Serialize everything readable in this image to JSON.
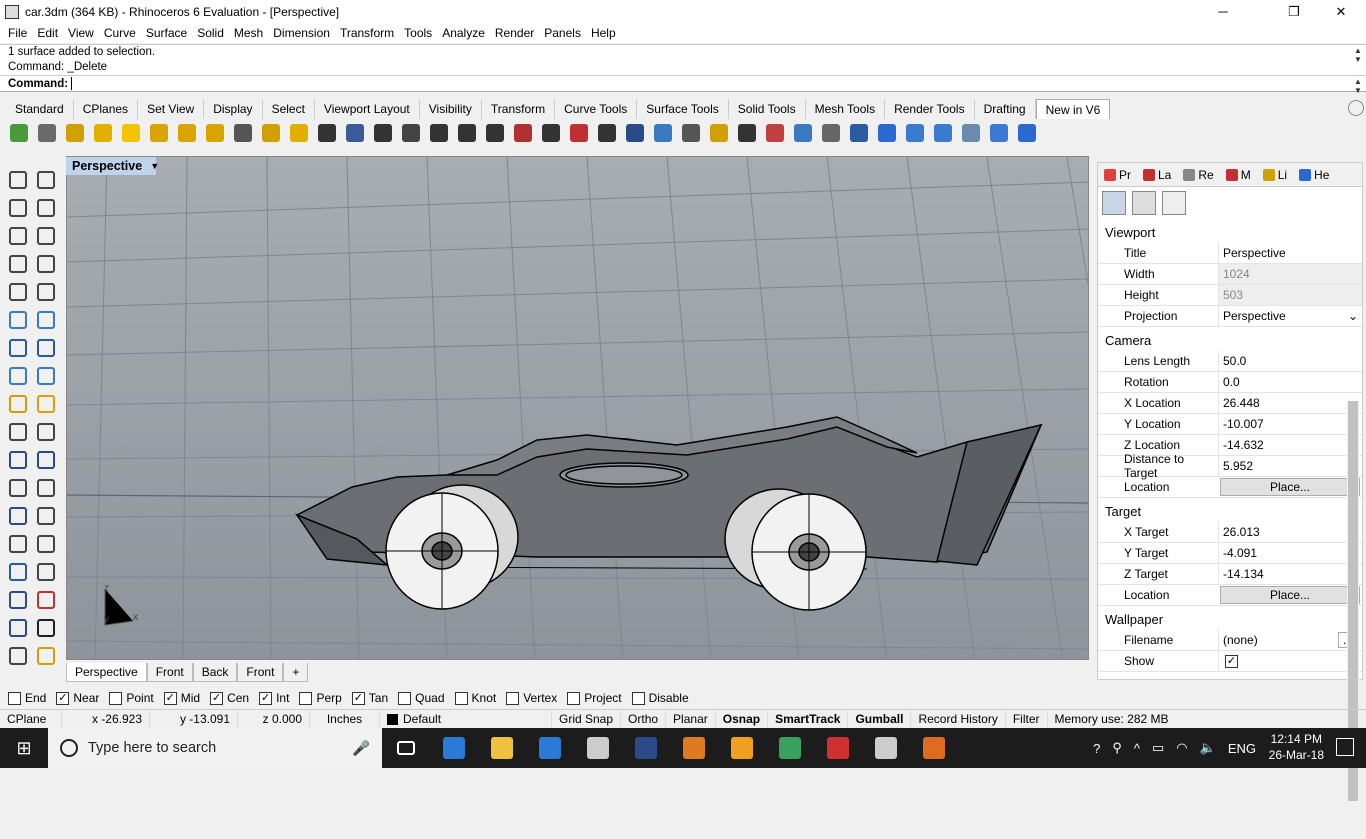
{
  "window": {
    "title": "car.3dm (364 KB) - Rhinoceros 6 Evaluation - [Perspective]",
    "controls": {
      "minimize": "─",
      "restore": "❐",
      "close": "✕"
    }
  },
  "menu": [
    "File",
    "Edit",
    "View",
    "Curve",
    "Surface",
    "Solid",
    "Mesh",
    "Dimension",
    "Transform",
    "Tools",
    "Analyze",
    "Render",
    "Panels",
    "Help"
  ],
  "command_history": [
    "1 surface added to selection.",
    "Command: _Delete"
  ],
  "command_prompt": "Command:",
  "toolbar_tabs": [
    "Standard",
    "CPlanes",
    "Set View",
    "Display",
    "Select",
    "Viewport Layout",
    "Visibility",
    "Transform",
    "Curve Tools",
    "Surface Tools",
    "Solid Tools",
    "Mesh Tools",
    "Render Tools",
    "Drafting",
    "New in V6"
  ],
  "toolbar_tabs_active": "New in V6",
  "toolbar_icons": [
    {
      "name": "sphere-icon",
      "color": "#4a9a3a"
    },
    {
      "name": "cplane-icon",
      "color": "#6a6a6a"
    },
    {
      "name": "lock-icon",
      "color": "#cfa000"
    },
    {
      "name": "picture-icon",
      "color": "#e1b000"
    },
    {
      "name": "light-icon",
      "color": "#f3c400"
    },
    {
      "name": "key-icon",
      "color": "#d9a300"
    },
    {
      "name": "point-icon",
      "color": "#d9a300"
    },
    {
      "name": "points-icon",
      "color": "#d9a300"
    },
    {
      "name": "rotate-icon",
      "color": "#555"
    },
    {
      "name": "grid-icon",
      "color": "#d0a000"
    },
    {
      "name": "box-icon",
      "color": "#e0b000"
    },
    {
      "name": "curve-icon",
      "color": "#333"
    },
    {
      "name": "brush-icon",
      "color": "#3a5a9a"
    },
    {
      "name": "fence-icon",
      "color": "#333"
    },
    {
      "name": "gauge-icon",
      "color": "#444"
    },
    {
      "name": "vsplit-icon",
      "color": "#333"
    },
    {
      "name": "lines-icon",
      "color": "#333"
    },
    {
      "name": "align-icon",
      "color": "#333"
    },
    {
      "name": "histogram-icon",
      "color": "#b03030"
    },
    {
      "name": "number-icon",
      "color": "#333"
    },
    {
      "name": "pen-icon",
      "color": "#c03030"
    },
    {
      "name": "sign-icon",
      "color": "#333"
    },
    {
      "name": "monitor-icon",
      "color": "#2a4a8a"
    },
    {
      "name": "drape-icon",
      "color": "#3a7ac0"
    },
    {
      "name": "wave-icon",
      "color": "#555"
    },
    {
      "name": "hook-icon",
      "color": "#d0a000"
    },
    {
      "name": "zoom-icon",
      "color": "#333"
    },
    {
      "name": "globe-icon",
      "color": "#c04040"
    },
    {
      "name": "select-icon",
      "color": "#3a7ac0"
    },
    {
      "name": "mesh-icon",
      "color": "#666"
    },
    {
      "name": "block-icon",
      "color": "#2a5aa0"
    },
    {
      "name": "download-icon",
      "color": "#2a6ad0"
    },
    {
      "name": "hexagon-icon",
      "color": "#3a7ad0"
    },
    {
      "name": "hexagon-outline-icon",
      "color": "#3a7ad0"
    },
    {
      "name": "chrome-icon",
      "color": "#6a8ab0"
    },
    {
      "name": "ski-icon",
      "color": "#3a7ad0"
    },
    {
      "name": "cube-select-icon",
      "color": "#2a6ad0"
    }
  ],
  "left_tools": [
    {
      "name": "select-arrow-icon",
      "color": "#444"
    },
    {
      "name": "point-dot-icon",
      "color": "#444"
    },
    {
      "name": "polyline-icon",
      "color": "#444"
    },
    {
      "name": "curve-points-icon",
      "color": "#444"
    },
    {
      "name": "circle-icon",
      "color": "#444"
    },
    {
      "name": "ellipse-icon",
      "color": "#444"
    },
    {
      "name": "polygon-icon",
      "color": "#444"
    },
    {
      "name": "rectangle-icon",
      "color": "#444"
    },
    {
      "name": "circle-center-icon",
      "color": "#444"
    },
    {
      "name": "fillet-icon",
      "color": "#444"
    },
    {
      "name": "surface-corners-icon",
      "color": "#3a7ac0"
    },
    {
      "name": "surface-edge-icon",
      "color": "#3a7ac0"
    },
    {
      "name": "box-solid-icon",
      "color": "#2a5aa0"
    },
    {
      "name": "spheres-icon",
      "color": "#2a5aa0"
    },
    {
      "name": "cylinder-icon",
      "color": "#3a7ac0"
    },
    {
      "name": "plane-mesh-icon",
      "color": "#3a7ac0"
    },
    {
      "name": "explode-icon",
      "color": "#d0a000"
    },
    {
      "name": "lightning-icon",
      "color": "#e0a000"
    },
    {
      "name": "split-icon",
      "color": "#444"
    },
    {
      "name": "trim-icon",
      "color": "#444"
    },
    {
      "name": "boolean-icon",
      "color": "#2a4a8a"
    },
    {
      "name": "group-icon",
      "color": "#2a4a8a"
    },
    {
      "name": "rebuild-icon",
      "color": "#444"
    },
    {
      "name": "extend-icon",
      "color": "#444"
    },
    {
      "name": "text-icon",
      "color": "#2a4a8a"
    },
    {
      "name": "dimension-icon",
      "color": "#444"
    },
    {
      "name": "array-icon",
      "color": "#444"
    },
    {
      "name": "bend-icon",
      "color": "#444"
    },
    {
      "name": "cube-blue-icon",
      "color": "#2a5aa0"
    },
    {
      "name": "curve-flat-icon",
      "color": "#444"
    },
    {
      "name": "points-grid-icon",
      "color": "#2a4a8a"
    },
    {
      "name": "gumball-icon",
      "color": "#c03030"
    },
    {
      "name": "paint-icon",
      "color": "#2a4a8a"
    },
    {
      "name": "check-icon",
      "color": "#222"
    },
    {
      "name": "render-icon",
      "color": "#444"
    },
    {
      "name": "material-icon",
      "color": "#d0a000"
    }
  ],
  "viewport": {
    "label": "Perspective",
    "axes": {
      "z": "z",
      "y": "y",
      "x": "x"
    },
    "tabs": [
      "Perspective",
      "Front",
      "Back",
      "Front"
    ],
    "tabs_active": "Perspective",
    "add_tab": "+"
  },
  "panel": {
    "tabs": [
      {
        "label": "Pr",
        "icon": "properties-icon",
        "color": "#e04040"
      },
      {
        "label": "La",
        "icon": "layers-icon",
        "color": "#c03030"
      },
      {
        "label": "Re",
        "icon": "render-settings-icon",
        "color": "#888"
      },
      {
        "label": "M",
        "icon": "materials-icon",
        "color": "#c03030"
      },
      {
        "label": "Li",
        "icon": "libraries-icon",
        "color": "#d0a000"
      },
      {
        "label": "He",
        "icon": "help-icon",
        "color": "#2a6ad0"
      }
    ],
    "viewport_section": "Viewport",
    "camera_section": "Camera",
    "target_section": "Target",
    "wallpaper_section": "Wallpaper",
    "viewport_props": [
      {
        "k": "Title",
        "v": "Perspective"
      },
      {
        "k": "Width",
        "v": "1024"
      },
      {
        "k": "Height",
        "v": "503"
      },
      {
        "k": "Projection",
        "v": "Perspective"
      }
    ],
    "camera_props": [
      {
        "k": "Lens Length",
        "v": "50.0"
      },
      {
        "k": "Rotation",
        "v": "0.0"
      },
      {
        "k": "X Location",
        "v": "26.448"
      },
      {
        "k": "Y Location",
        "v": "-10.007"
      },
      {
        "k": "Z Location",
        "v": "-14.632"
      },
      {
        "k": "Distance to Target",
        "v": "5.952"
      },
      {
        "k": "Location",
        "v": "Place..."
      }
    ],
    "target_props": [
      {
        "k": "X Target",
        "v": "26.013"
      },
      {
        "k": "Y Target",
        "v": "-4.091"
      },
      {
        "k": "Z Target",
        "v": "-14.134"
      },
      {
        "k": "Location",
        "v": "Place..."
      }
    ],
    "wallpaper_props": [
      {
        "k": "Filename",
        "v": "(none)"
      },
      {
        "k": "Show",
        "v": "✓"
      }
    ],
    "filename_button": "..."
  },
  "osnaps": [
    {
      "label": "End",
      "checked": false
    },
    {
      "label": "Near",
      "checked": true
    },
    {
      "label": "Point",
      "checked": false
    },
    {
      "label": "Mid",
      "checked": true
    },
    {
      "label": "Cen",
      "checked": true
    },
    {
      "label": "Int",
      "checked": true
    },
    {
      "label": "Perp",
      "checked": false
    },
    {
      "label": "Tan",
      "checked": true
    },
    {
      "label": "Quad",
      "checked": false
    },
    {
      "label": "Knot",
      "checked": false
    },
    {
      "label": "Vertex",
      "checked": false
    },
    {
      "label": "Project",
      "checked": false
    },
    {
      "label": "Disable",
      "checked": false
    }
  ],
  "status": {
    "cplane": "CPlane",
    "x": "x -26.923",
    "y": "y -13.091",
    "z": "z 0.000",
    "units": "Inches",
    "layer": "Default",
    "toggles": [
      "Grid Snap",
      "Ortho",
      "Planar",
      "Osnap",
      "SmartTrack",
      "Gumball",
      "Record History",
      "Filter"
    ],
    "bold_toggles": [
      "Osnap",
      "SmartTrack",
      "Gumball"
    ],
    "memory": "Memory use: 282 MB"
  },
  "taskbar": {
    "search_placeholder": "Type here to search",
    "apps": [
      {
        "name": "task-view-icon",
        "color": "#ffffff"
      },
      {
        "name": "edge-icon",
        "color": "#2a7ad6"
      },
      {
        "name": "file-explorer-icon",
        "color": "#f0c040"
      },
      {
        "name": "store-icon",
        "color": "#2a7ad6"
      },
      {
        "name": "camera-app-icon",
        "color": "#cccccc"
      },
      {
        "name": "photoshop-icon",
        "color": "#2a4a8a"
      },
      {
        "name": "e-app-icon",
        "color": "#e07a20"
      },
      {
        "name": "f-app-icon",
        "color": "#f0a020"
      },
      {
        "name": "atom-icon",
        "color": "#3aa060"
      },
      {
        "name": "red-app-icon",
        "color": "#d03030"
      },
      {
        "name": "rhino-icon",
        "color": "#cccccc"
      },
      {
        "name": "firefox-icon",
        "color": "#e06a20"
      }
    ],
    "tray": [
      "?",
      "⚲",
      "^",
      "▭",
      "◠",
      "🔈",
      "ENG"
    ],
    "time": "12:14 PM",
    "date": "26-Mar-18"
  }
}
